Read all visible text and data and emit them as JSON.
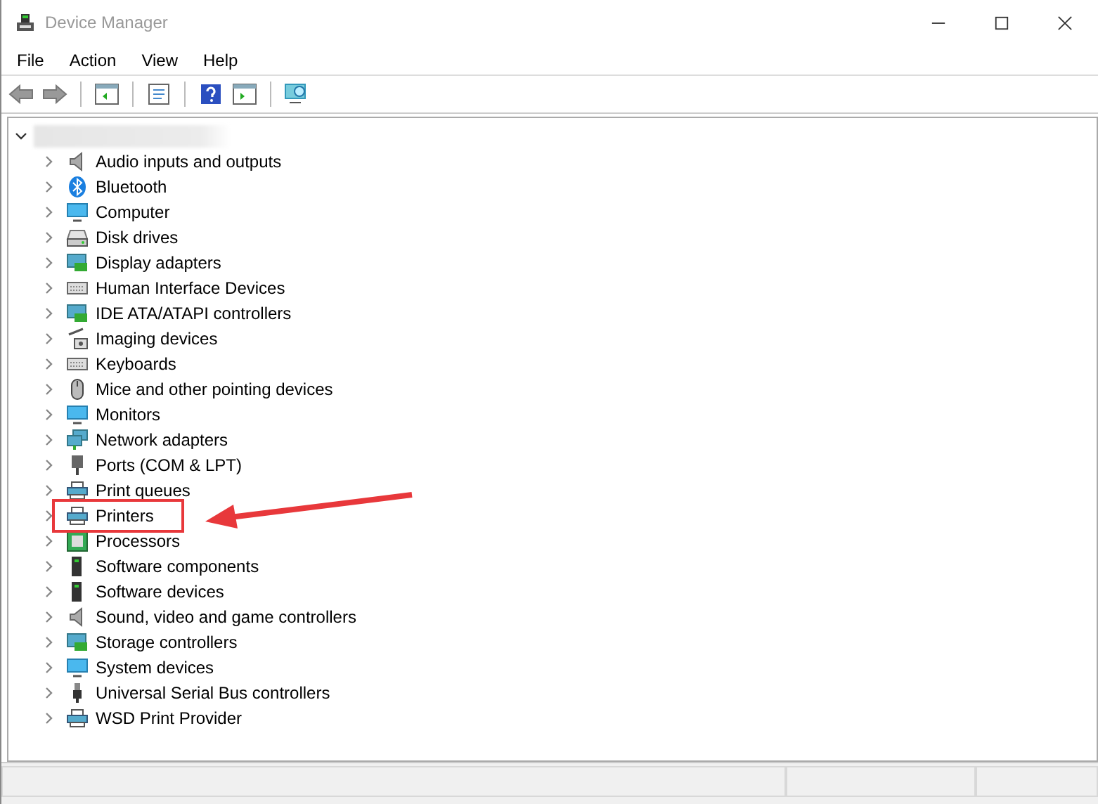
{
  "window": {
    "title": "Device Manager"
  },
  "menu": [
    "File",
    "Action",
    "View",
    "Help"
  ],
  "tree": {
    "expanded": true,
    "children": [
      {
        "label": "Audio inputs and outputs",
        "expanded": false,
        "highlighted": false
      },
      {
        "label": "Bluetooth",
        "expanded": false,
        "highlighted": false
      },
      {
        "label": "Computer",
        "expanded": false,
        "highlighted": false
      },
      {
        "label": "Disk drives",
        "expanded": false,
        "highlighted": false
      },
      {
        "label": "Display adapters",
        "expanded": false,
        "highlighted": false
      },
      {
        "label": "Human Interface Devices",
        "expanded": false,
        "highlighted": false
      },
      {
        "label": "IDE ATA/ATAPI controllers",
        "expanded": false,
        "highlighted": false
      },
      {
        "label": "Imaging devices",
        "expanded": false,
        "highlighted": false
      },
      {
        "label": "Keyboards",
        "expanded": false,
        "highlighted": false
      },
      {
        "label": "Mice and other pointing devices",
        "expanded": false,
        "highlighted": false
      },
      {
        "label": "Monitors",
        "expanded": false,
        "highlighted": false
      },
      {
        "label": "Network adapters",
        "expanded": false,
        "highlighted": false
      },
      {
        "label": "Ports (COM & LPT)",
        "expanded": false,
        "highlighted": false
      },
      {
        "label": "Print queues",
        "expanded": false,
        "highlighted": false
      },
      {
        "label": "Printers",
        "expanded": false,
        "highlighted": true
      },
      {
        "label": "Processors",
        "expanded": false,
        "highlighted": false
      },
      {
        "label": "Software components",
        "expanded": false,
        "highlighted": false
      },
      {
        "label": "Software devices",
        "expanded": false,
        "highlighted": false
      },
      {
        "label": "Sound, video and game controllers",
        "expanded": false,
        "highlighted": false
      },
      {
        "label": "Storage controllers",
        "expanded": false,
        "highlighted": false
      },
      {
        "label": "System devices",
        "expanded": false,
        "highlighted": false
      },
      {
        "label": "Universal Serial Bus controllers",
        "expanded": false,
        "highlighted": false
      },
      {
        "label": "WSD Print Provider",
        "expanded": false,
        "highlighted": false
      }
    ]
  }
}
